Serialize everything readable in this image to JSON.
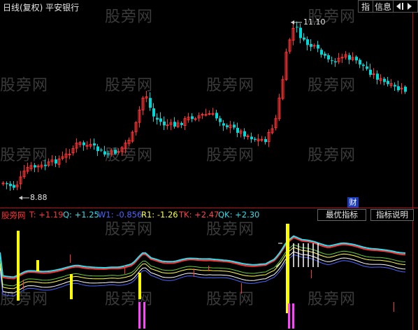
{
  "header": {
    "title": "日线(复权) 平安银行",
    "buttons": [
      "指",
      "信息"
    ],
    "nav_icon": "arrow-icons"
  },
  "watermark": "股旁网",
  "price_annotations": {
    "high": "11.10",
    "low": "8.88"
  },
  "caibadge": "财",
  "indicator": {
    "name": "股旁网",
    "values": [
      {
        "label": "T:",
        "value": "+1.19",
        "color": "#ff3333"
      },
      {
        "label": "Q:",
        "value": "+1.25",
        "color": "#33ddee"
      },
      {
        "label": "W1:",
        "value": "-0.856",
        "color": "#4a66ff"
      },
      {
        "label": "R1:",
        "value": "-1.26",
        "color": "#ffff44"
      },
      {
        "label": "TK:",
        "value": "+2.47",
        "color": "#ff4444"
      },
      {
        "label": "QK:",
        "value": "+2.30",
        "color": "#33ddee"
      }
    ],
    "buttons": [
      "最优指标",
      "指标说明"
    ]
  },
  "colors": {
    "up": "#ff3333",
    "down": "#00d8d8",
    "bg": "#000000",
    "frame": "#b01010"
  }
}
